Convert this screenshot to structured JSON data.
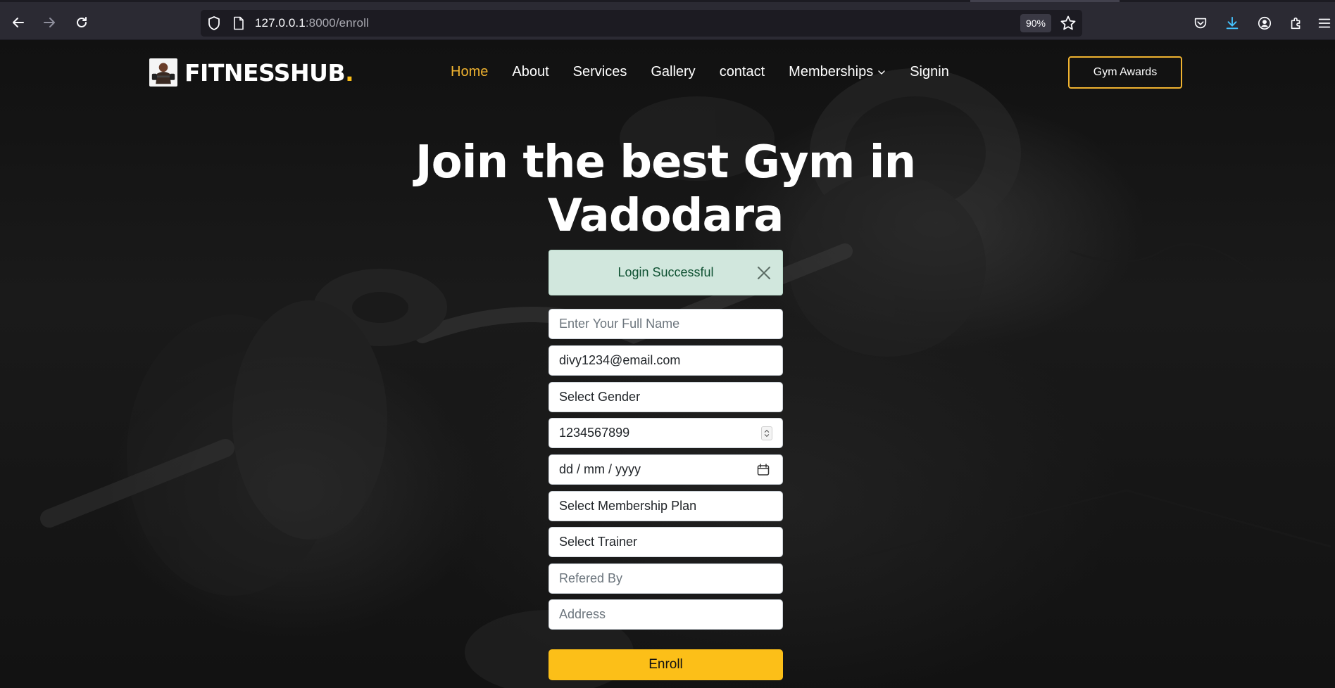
{
  "browser": {
    "url_host": "127.0.0.1",
    "url_rest": ":8000/enroll",
    "zoom": "90%"
  },
  "header": {
    "logo_text": "FITNESSHUB",
    "logo_dot": ".",
    "nav": {
      "home": "Home",
      "about": "About",
      "services": "Services",
      "gallery": "Gallery",
      "contact": "contact",
      "memberships": "Memberships",
      "signin": "Signin"
    },
    "cta_label": "Gym Awards"
  },
  "hero": {
    "title_line1": "Join the best Gym in",
    "title_line2": "Vadodara"
  },
  "alert": {
    "message": "Login Successful"
  },
  "form": {
    "full_name_placeholder": "Enter Your Full Name",
    "email_value": "divy1234@email.com",
    "gender_selected": "Select Gender",
    "phone_value": "1234567899",
    "dob_placeholder": "dd / mm / yyyy",
    "membership_selected": "Select Membership Plan",
    "trainer_selected": "Select Trainer",
    "referred_placeholder": "Refered By",
    "address_placeholder": "Address",
    "submit_label": "Enroll"
  },
  "colors": {
    "accent": "#fcbf18",
    "nav_active": "#f0b330",
    "alert_bg": "#d1e7dd",
    "alert_text": "#0f5132"
  },
  "icons": {
    "back": "arrow-left-icon",
    "forward": "arrow-right-icon",
    "reload": "reload-icon",
    "shield": "tracking-shield-icon",
    "page": "page-icon",
    "bookmark": "star-icon",
    "pocket": "pocket-icon",
    "downloads": "download-icon",
    "account": "account-icon",
    "extensions": "extensions-icon",
    "menu": "hamburger-menu-icon",
    "dropdown": "chevron-down-icon",
    "close": "close-icon",
    "calendar": "calendar-icon"
  }
}
